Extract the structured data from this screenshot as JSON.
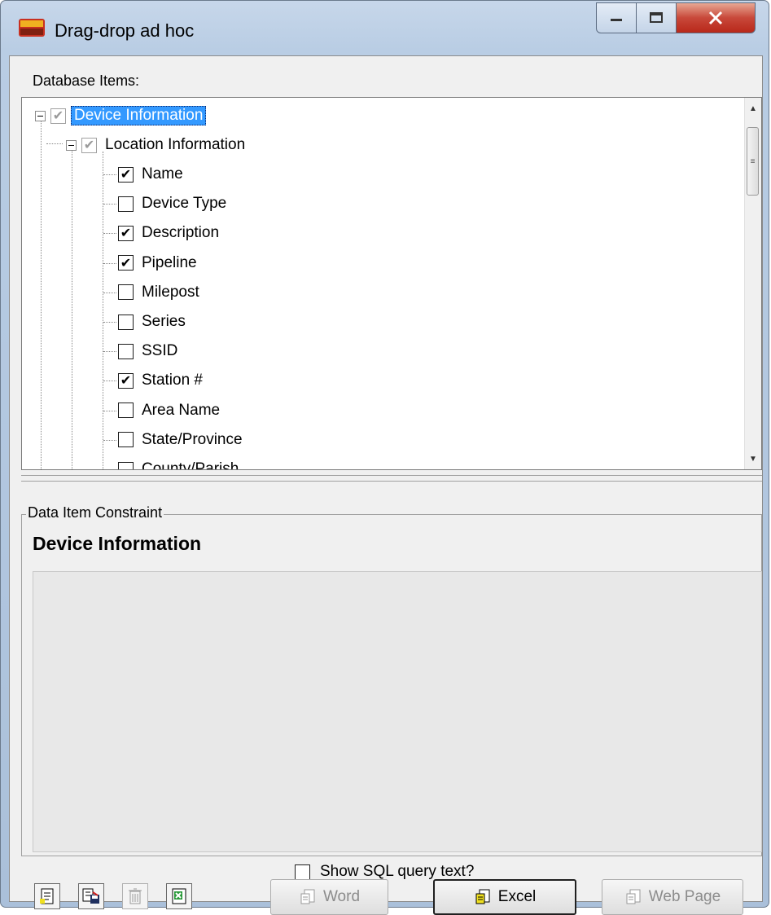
{
  "window": {
    "title": "Drag-drop ad hoc",
    "controls": {
      "minimize": "—",
      "maximize": "□",
      "close": "X"
    }
  },
  "database_items": {
    "label": "Database Items:",
    "tree": {
      "root": {
        "label": "Device Information",
        "checked": true,
        "selected": true
      },
      "group": {
        "label": "Location Information",
        "checked": true
      },
      "items": [
        {
          "label": "Name",
          "checked": true
        },
        {
          "label": "Device Type",
          "checked": false
        },
        {
          "label": "Description",
          "checked": true
        },
        {
          "label": "Pipeline",
          "checked": true
        },
        {
          "label": "Milepost",
          "checked": false
        },
        {
          "label": "Series",
          "checked": false
        },
        {
          "label": "SSID",
          "checked": false
        },
        {
          "label": "Station #",
          "checked": true
        },
        {
          "label": "Area Name",
          "checked": false
        },
        {
          "label": "State/Province",
          "checked": false
        },
        {
          "label": "County/Parish",
          "checked": false
        }
      ]
    }
  },
  "constraint": {
    "legend": "Data Item Constraint",
    "title": "Device Information"
  },
  "show_sql": {
    "label": "Show SQL query text?",
    "checked": false
  },
  "toolbar": {
    "icons": [
      "new-query-icon",
      "save-query-icon",
      "delete-icon",
      "excel-export-icon"
    ]
  },
  "buttons": {
    "word": "Word",
    "excel": "Excel",
    "web": "Web Page"
  },
  "check_glyph": "✔"
}
